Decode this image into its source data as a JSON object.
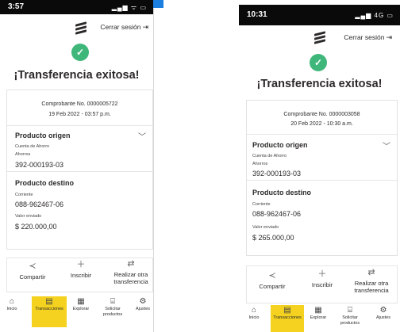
{
  "left": {
    "status_time": "3:57",
    "status_icons": "▂▄▆ ᯤ ▭",
    "logout_label": "Cerrar sesión",
    "title": "¡Transferencia exitosa!",
    "receipt_no": "Comprobante No. 0000005722",
    "receipt_date": "19 Feb 2022 - 03:57 p.m.",
    "origin_heading": "Producto origen",
    "origin_account_type": "Cuenta de Ahorro",
    "origin_sub": "Ahorros",
    "origin_number": "392-000193-03",
    "dest_heading": "Producto destino",
    "dest_type": "Corriente",
    "dest_number": "088-962467-06",
    "amount_label": "Valor enviado",
    "amount": "$ 220.000,00",
    "actions": {
      "share": "Compartir",
      "enroll": "Inscribir",
      "again": "Realizar otra transferencia"
    },
    "nav": {
      "home": "Inicio",
      "transactions": "Transacciones",
      "explore": "Explorar",
      "request": "Solicitar productos",
      "settings": "Ajustes"
    }
  },
  "right": {
    "status_time": "10:31",
    "status_icons": "▂▄▆ 4G ▭",
    "logout_label": "Cerrar sesión",
    "title": "¡Transferencia exitosa!",
    "receipt_no": "Comprobante No. 0000003058",
    "receipt_date": "20 Feb 2022 - 10:30 a.m.",
    "origin_heading": "Producto origen",
    "origin_account_type": "Cuenta de Ahorro",
    "origin_sub": "Ahorros",
    "origin_number": "392-000193-03",
    "dest_heading": "Producto destino",
    "dest_type": "Corriente",
    "dest_number": "088-962467-06",
    "amount_label": "Valor enviado",
    "amount": "$ 265.000,00",
    "actions": {
      "share": "Compartir",
      "enroll": "Inscribir",
      "again": "Realizar otra transferencia"
    },
    "nav": {
      "home": "Inicio",
      "transactions": "Transacciones",
      "explore": "Explorar",
      "request": "Solicitar productos",
      "settings": "Ajustes"
    }
  },
  "colors": {
    "success": "#3fb77a",
    "accent_yellow": "#f4d21f",
    "status_bar": "#0a0a0a",
    "brand_blue": "#1c7fe0"
  },
  "icons": {
    "logo": "bancolombia-logo-icon",
    "logout": "logout-icon",
    "check": "check-icon",
    "chevron": "chevron-down-icon",
    "share": "share-icon",
    "enroll": "plus-icon",
    "again": "transfer-icon",
    "home": "home-icon",
    "transactions": "transactions-icon",
    "explore": "grid-icon",
    "request": "basket-icon",
    "settings": "gear-icon"
  }
}
